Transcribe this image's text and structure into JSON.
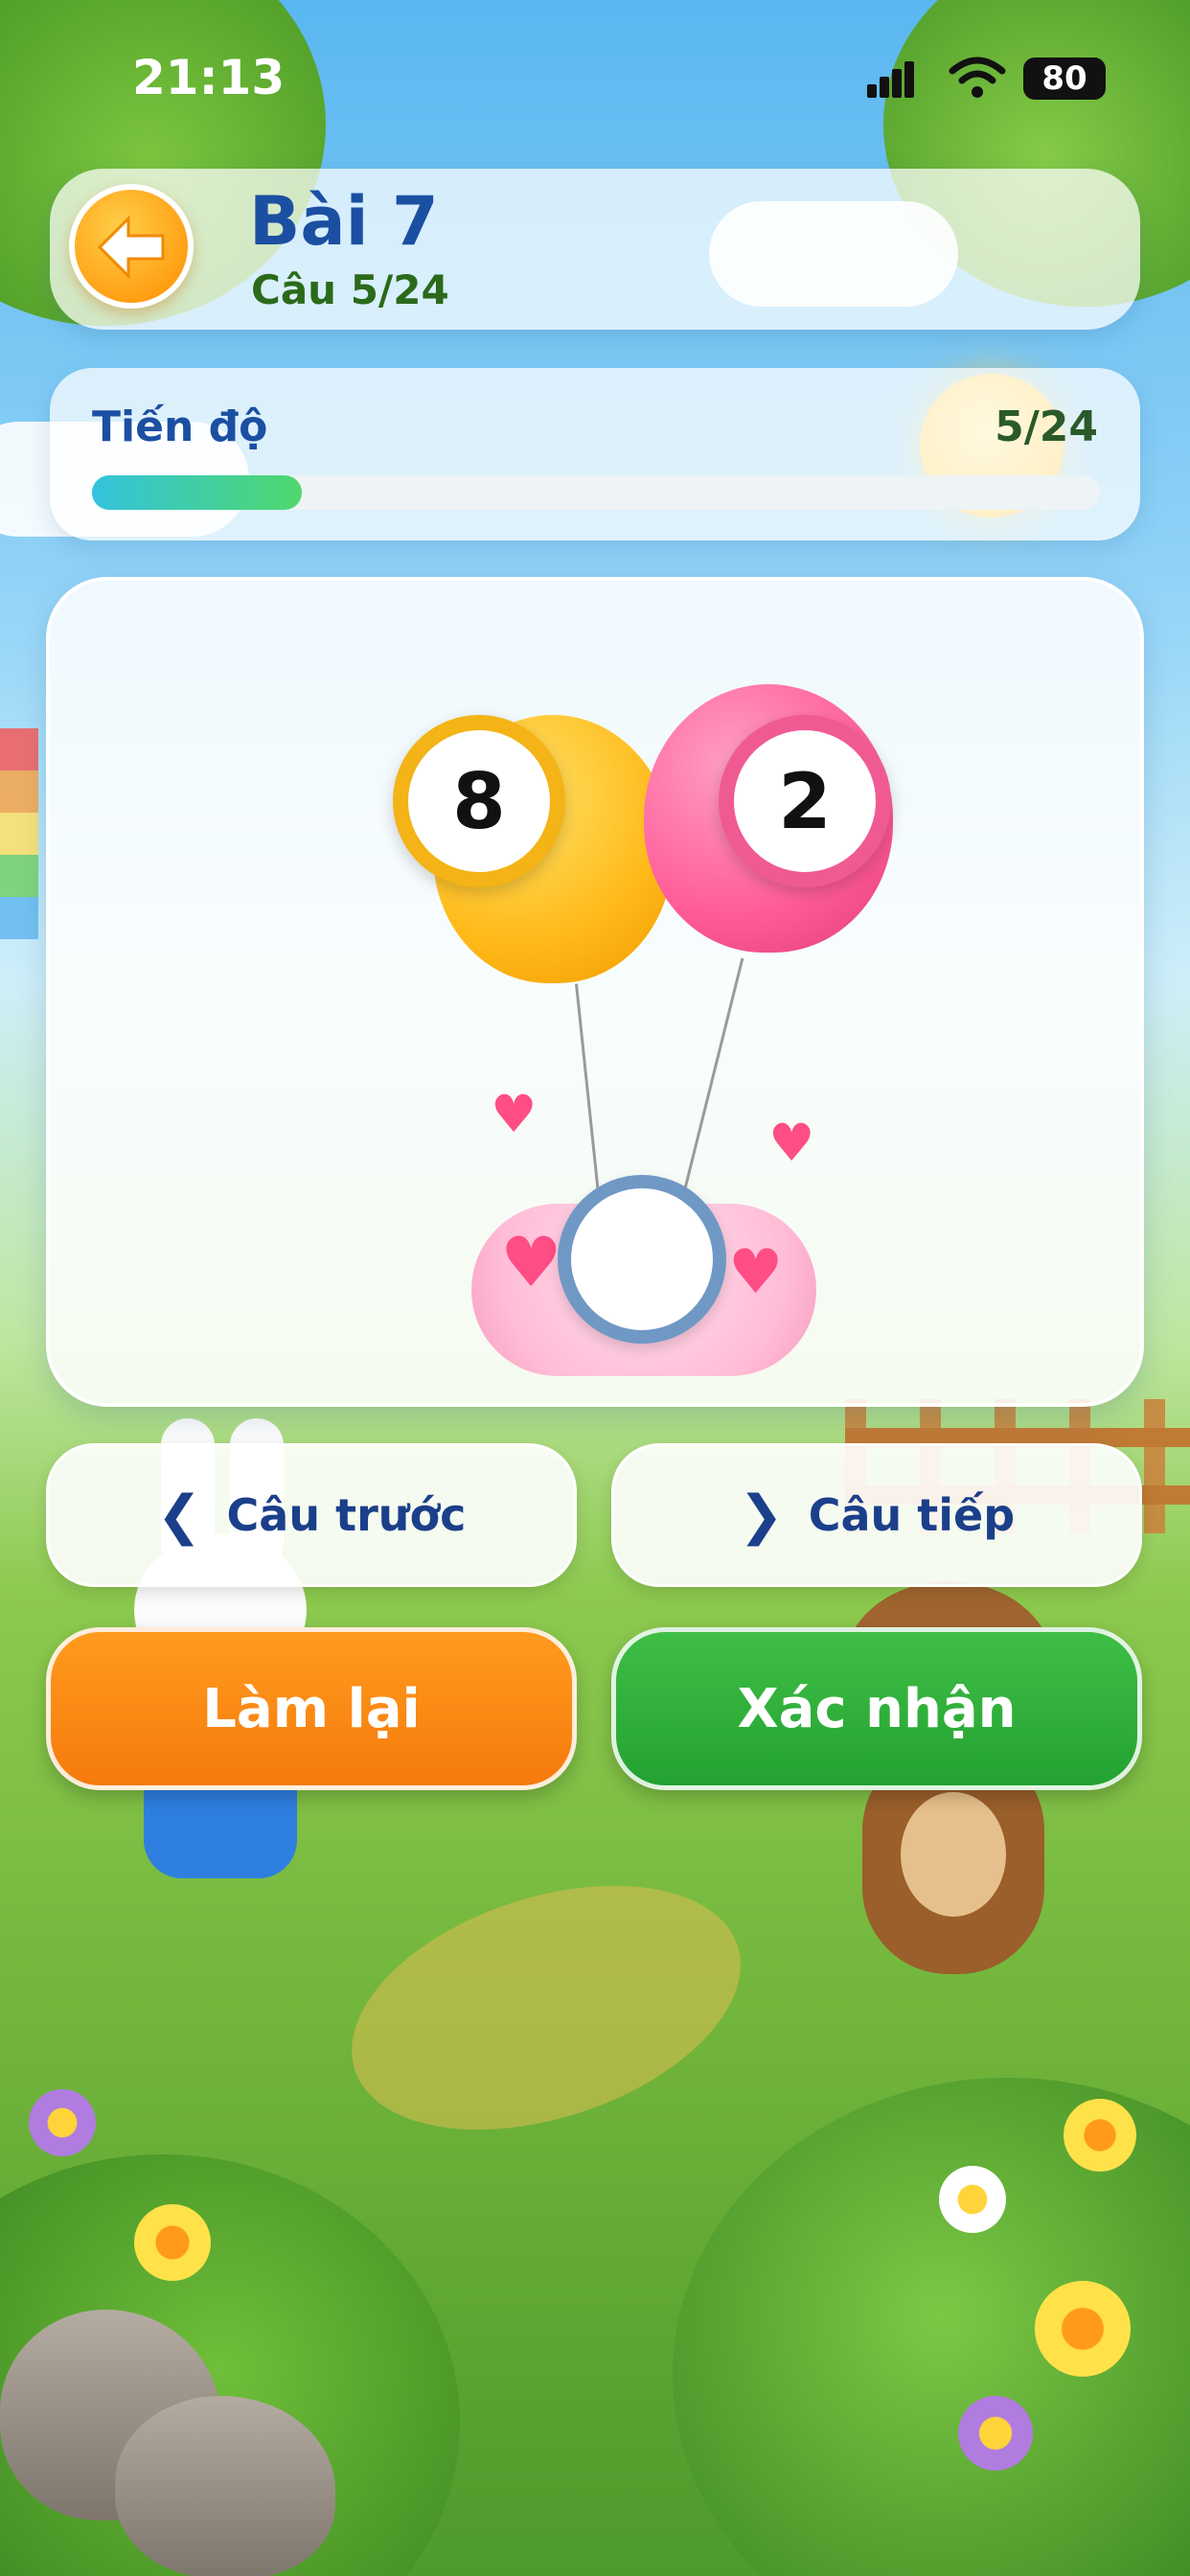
{
  "status_bar": {
    "time": "21:13",
    "battery": "80"
  },
  "header": {
    "back_icon": "arrow-left-icon",
    "title": "Bài 7",
    "subtitle": "Câu 5/24"
  },
  "progress": {
    "label": "Tiến độ",
    "count": "5/24",
    "fraction": 0.2083
  },
  "question": {
    "balloon_left_value": "8",
    "balloon_right_value": "2",
    "answer_value": ""
  },
  "navigation": {
    "prev_label": "Câu trước",
    "next_label": "Câu tiếp"
  },
  "actions": {
    "reset_label": "Làm lại",
    "confirm_label": "Xác nhận"
  },
  "colors": {
    "title": "#1b4fa2",
    "reset": "#f57a0c",
    "confirm": "#23a232",
    "balloon_left": "#ffba1a",
    "balloon_right": "#ff5d99"
  }
}
